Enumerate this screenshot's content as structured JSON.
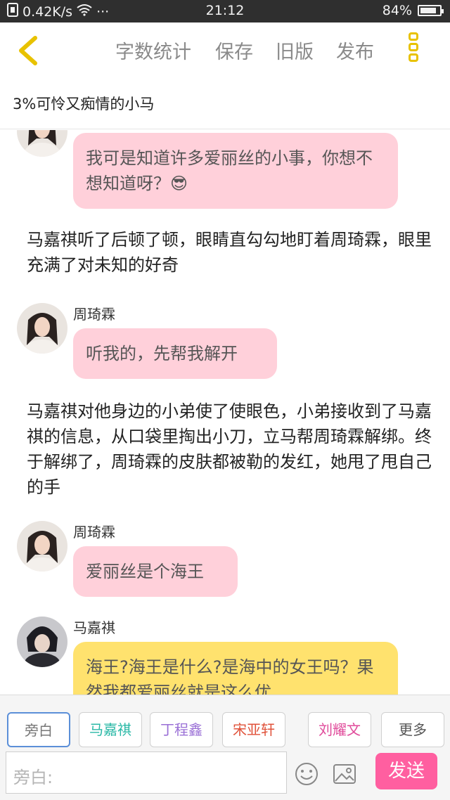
{
  "status_bar": {
    "network": "0.42K/s",
    "time": "21:12",
    "battery": "84%",
    "battery_level": 0.84
  },
  "toolbar": {
    "word_count": "字数统计",
    "save": "保存",
    "old_version": "旧版",
    "publish": "发布"
  },
  "story_title": "3%可怜又痴情的小马",
  "messages": [
    {
      "text": "我可是知道许多爱丽丝的小事，你想不想知道呀？😎"
    },
    {
      "text": "马嘉祺听了后顿了顿，眼睛直勾勾地盯着周琦霖，眼里充满了对未知的好奇"
    },
    {
      "speaker": "周琦霖",
      "text": "听我的，先帮我解开"
    },
    {
      "text": "马嘉祺对他身边的小弟使了使眼色，小弟接收到了马嘉祺的信息，从口袋里掏出小刀，立马帮周琦霖解绑。终于解绑了，周琦霖的皮肤都被勒的发红，她甩了甩自己的手"
    },
    {
      "speaker": "周琦霖",
      "text": "爱丽丝是个海王"
    },
    {
      "speaker": "马嘉祺",
      "text": "海王?海王是什么?是海中的女王吗？果然我都爱丽丝就是这么优"
    }
  ],
  "role_chips": [
    {
      "label": "旁白",
      "color": "#777777"
    },
    {
      "label": "马嘉祺",
      "color": "#2ab8a6"
    },
    {
      "label": "丁程鑫",
      "color": "#9a6fd6"
    },
    {
      "label": "宋亚轩",
      "color": "#e0523a"
    },
    {
      "label": "刘耀文",
      "color": "#e04a9a"
    },
    {
      "label": "更多",
      "color": "#555555"
    }
  ],
  "input": {
    "placeholder": "旁白:"
  },
  "send_label": "发送",
  "colors": {
    "accent_yellow": "#e8c200",
    "bubble_pink": "#ffd0da",
    "bubble_yellow": "#ffe26e",
    "send_pink": "#ff5fa0"
  },
  "icons": [
    "back-chevron-icon",
    "more-icon",
    "emoji-icon",
    "image-icon",
    "wifi-icon",
    "sim-icon",
    "battery-icon"
  ]
}
